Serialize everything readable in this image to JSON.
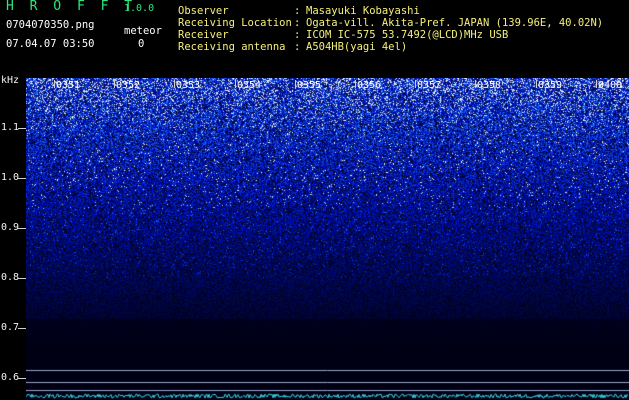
{
  "header": {
    "app_title": "H R O F F T",
    "app_version": "1.0.0",
    "filename": "0704070350.png",
    "detection_label": "meteor",
    "timestamp": "07.04.07 03:50",
    "detection_count": "0",
    "info": [
      {
        "label": "Observer",
        "value": "Masayuki Kobayashi"
      },
      {
        "label": "Receiving Location",
        "value": "Ogata-vill. Akita-Pref. JAPAN (139.96E, 40.02N)"
      },
      {
        "label": "Receiver",
        "value": "ICOM IC-575 53.7492(@LCD)MHz USB"
      },
      {
        "label": "Receiving antenna",
        "value": "A504HB(yagi 4el)"
      }
    ]
  },
  "spectrogram": {
    "y_unit": "kHz",
    "y_ticks": [
      "1.1",
      "1.0",
      "0.9",
      "0.8",
      "0.7",
      "0.6"
    ],
    "x_ticks": [
      "0351",
      "0352",
      "0353",
      "0354",
      "0355",
      "0356",
      "0357",
      "0358",
      "0359",
      "0400"
    ],
    "colors": {
      "low": "#000010",
      "mid": "#1a30c8",
      "high": "#ffffff",
      "marker": "#9aa6c8",
      "baseline": "#3ad8e8"
    }
  }
}
